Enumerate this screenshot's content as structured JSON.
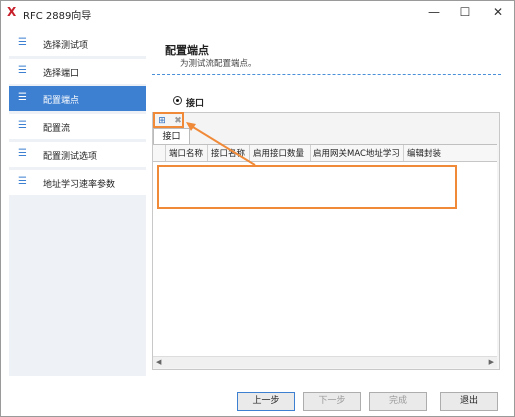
{
  "window": {
    "logo": "X",
    "title": "RFC 2889向导",
    "min": "—",
    "max": "☐",
    "close": "✕"
  },
  "sidebar": {
    "items": [
      {
        "label": "选择测试项",
        "icon": "list-icon"
      },
      {
        "label": "选择端口",
        "icon": "list-icon"
      },
      {
        "label": "配置端点",
        "icon": "list-icon",
        "active": true
      },
      {
        "label": "配置流",
        "icon": "list-icon"
      },
      {
        "label": "配置测试选项",
        "icon": "list-icon"
      },
      {
        "label": "地址学习速率参数",
        "icon": "list-icon"
      }
    ],
    "bullet": "☰"
  },
  "content": {
    "title": "配置端点",
    "subtitle": "为测试流配置端点。"
  },
  "radio": {
    "label": "接口",
    "selected": true
  },
  "toolbar": {
    "add_icon": "⊞",
    "delete_icon": "✖"
  },
  "tab": {
    "label": "接口"
  },
  "grid": {
    "columns": [
      "端口名称",
      "接口名称",
      "启用接口数量",
      "启用网关MAC地址学习",
      "编辑封装"
    ],
    "rows": []
  },
  "scroll": {
    "left": "◀",
    "right": "▶"
  },
  "buttons": {
    "prev": "上一步",
    "next": "下一步",
    "finish": "完成",
    "exit": "退出"
  },
  "colors": {
    "accent": "#3d7fd1",
    "highlight": "#f08a38"
  }
}
